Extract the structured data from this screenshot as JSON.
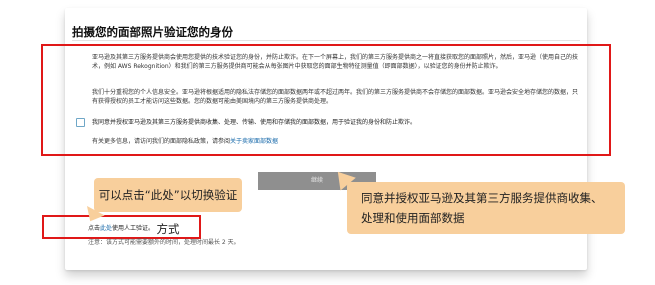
{
  "page_title": "拍摄您的面部照片验证您的身份",
  "paragraph1": "亚马逊及其第三方服务提供商会使用您提供的技术验证您的身份，并防止欺诈。在下一个屏幕上，我们的第三方服务提供商之一将直接获取您的面部照片，然后，亚马逊（使用自己的技术，例如 AWS Rekognition）和我们的第三方服务提供商可能会从每张图片中获取您的面部生物特征测量值（即面部数据），以验证您的身份并防止欺诈。",
  "paragraph2": "我们十分重视您的个人信息安全。亚马逊将根据适用的隐私法存储您的面部数据两年或不超过两年。我们的第三方服务提供商不会存储您的面部数据。亚马逊会安全地存储您的数据，只有获得授权的员工才能访问这些数据。您的数据可能由美国境内的第三方服务提供商处理。",
  "consent_text": "我同意并授权亚马逊及其第三方服务提供商收集、处理、传输、使用和存储我的面部数据，用于验证我的身份和防止欺诈。",
  "more_info_prefix": "有关更多信息，请访问我们的面部隐私政策，请参阅",
  "more_info_link": "关于卖家面部数据",
  "continue_label": "继续",
  "alt_prefix": "点击",
  "alt_link": "此处",
  "alt_suffix": "使用人工验证。",
  "note_text": "注意：该方式可能需要额外的时间，处理时间最长 2 天。",
  "callout_left": "可以点击“此处”以切换验证方式",
  "callout_right": "同意并授权亚马逊及其第三方服务提供商收集、处理和使用面部数据",
  "colors": {
    "highlight_red": "#e01818",
    "callout_orange": "#f8cf9c",
    "link_blue": "#1769aa",
    "button_grey": "#8f8f8f"
  }
}
